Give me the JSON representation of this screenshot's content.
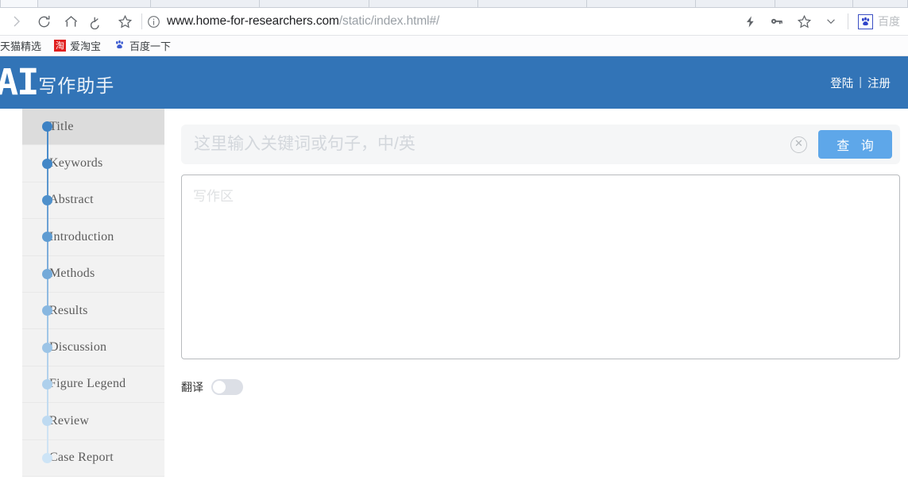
{
  "browser": {
    "tabs_visible_count": 10,
    "nav_icons": [
      {
        "name": "forward-icon",
        "glyph": "›"
      },
      {
        "name": "reload-icon",
        "glyph": "↻"
      },
      {
        "name": "home-icon",
        "glyph": "⌂"
      },
      {
        "name": "undo-icon",
        "glyph": "↩"
      },
      {
        "name": "bookmark-star-icon",
        "glyph": "☆"
      }
    ],
    "url": {
      "info_icon": "info-circle-icon",
      "domain": "www.home-for-researchers.com",
      "path": "/static/index.html#/"
    },
    "right_icons": [
      {
        "name": "lightning-icon",
        "glyph": "⚡"
      },
      {
        "name": "key-icon",
        "glyph": "⚷"
      },
      {
        "name": "star-icon",
        "glyph": "☆"
      },
      {
        "name": "chevron-down-icon",
        "glyph": "⌄"
      }
    ],
    "extension": {
      "icon": "baidu-paw-icon",
      "glyph": "✿",
      "label": "百度"
    },
    "bookmarks": [
      {
        "name": "bookmark-tmall",
        "label": "天猫精选",
        "icon": null
      },
      {
        "name": "bookmark-itaobao",
        "label": "爱淘宝",
        "icon": "taobao-icon",
        "icon_text": "淘"
      },
      {
        "name": "bookmark-baidu",
        "label": "百度一下",
        "icon": "baidu-paw-icon",
        "icon_text": "✿"
      }
    ]
  },
  "header": {
    "brand_mark": "AI",
    "brand_text": "写作助手",
    "login_label": "登陆",
    "separator": "|",
    "register_label": "注册",
    "background_color": "#3274b7"
  },
  "sidebar": {
    "background_color": "#f2f2f2",
    "active_background_color": "#dcdcdc",
    "items": [
      {
        "label": "Title",
        "dot_color": "#3d82c4",
        "line_color": "#4a8ccb",
        "active": true
      },
      {
        "label": "Keywords",
        "dot_color": "#4287c7",
        "line_color": "#5a96ce",
        "active": false
      },
      {
        "label": "Abstract",
        "dot_color": "#4f90cb",
        "line_color": "#6ba0d4",
        "active": false
      },
      {
        "label": "Introduction",
        "dot_color": "#5f9cd2",
        "line_color": "#7dadda",
        "active": false
      },
      {
        "label": "Methods",
        "dot_color": "#74aad9",
        "line_color": "#8fbae1",
        "active": false
      },
      {
        "label": "Results",
        "dot_color": "#88b7e0",
        "line_color": "#a0c6e7",
        "active": false
      },
      {
        "label": "Discussion",
        "dot_color": "#9cc4e6",
        "line_color": "#b2d1ec",
        "active": false
      },
      {
        "label": "Figure Legend",
        "dot_color": "#aed0ec",
        "line_color": "#c2dbf0",
        "active": false
      },
      {
        "label": "Review",
        "dot_color": "#bedaf1",
        "line_color": "#cfe3f4",
        "active": false
      },
      {
        "label": "Case Report",
        "dot_color": "#cde4f6",
        "line_color": "#cde4f6",
        "active": false
      }
    ]
  },
  "main": {
    "search": {
      "placeholder": "这里输入关键词或句子，中/英",
      "value": "",
      "clear_icon": "✕",
      "button_label": "查 询",
      "button_color": "#5ea7e9"
    },
    "editor": {
      "placeholder": "写作区",
      "value": ""
    },
    "translate": {
      "label": "翻译",
      "enabled": false
    }
  }
}
